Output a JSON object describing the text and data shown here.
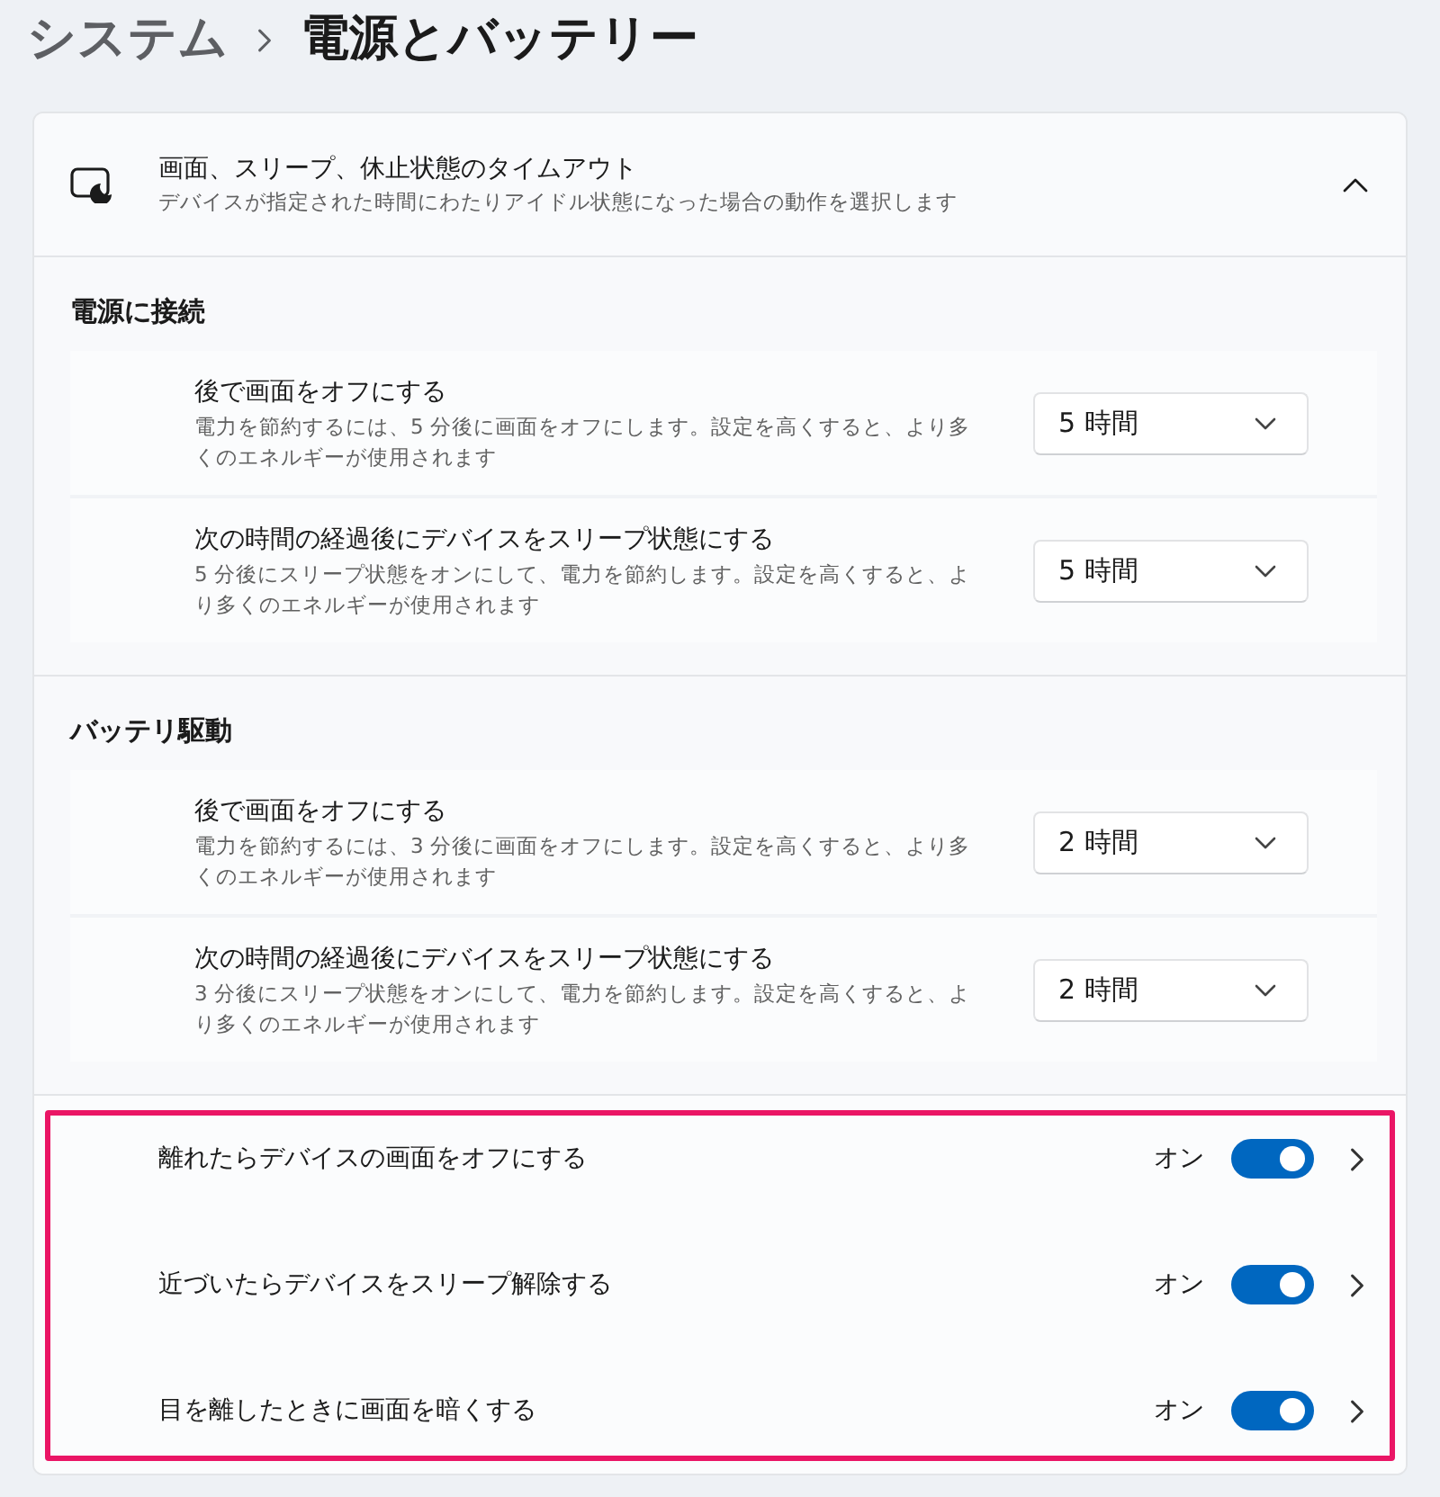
{
  "breadcrumb": [
    {
      "label": "システム",
      "current": false
    },
    {
      "label": "電源とバッテリー",
      "current": true
    }
  ],
  "panel": {
    "title": "画面、スリープ、休止状態のタイムアウト",
    "subtitle": "デバイスが指定された時間にわたりアイドル状態になった場合の動作を選択します",
    "expanded": true,
    "groups": [
      {
        "heading": "電源に接続",
        "settings": [
          {
            "label": "後で画面をオフにする",
            "description": "電力を節約するには、5 分後に画面をオフにします。設定を高くすると、より多くのエネルギーが使用されます",
            "value": "5 時間"
          },
          {
            "label": "次の時間の経過後にデバイスをスリープ状態にする",
            "description": "5 分後にスリープ状態をオンにして、電力を節約します。設定を高くすると、より多くのエネルギーが使用されます",
            "value": "5 時間"
          }
        ]
      },
      {
        "heading": "バッテリ駆動",
        "settings": [
          {
            "label": "後で画面をオフにする",
            "description": "電力を節約するには、3 分後に画面をオフにします。設定を高くすると、より多くのエネルギーが使用されます",
            "value": "2 時間"
          },
          {
            "label": "次の時間の経過後にデバイスをスリープ状態にする",
            "description": "3 分後にスリープ状態をオンにして、電力を節約します。設定を高くすると、より多くのエネルギーが使用されます",
            "value": "2 時間"
          }
        ]
      }
    ]
  },
  "presence": {
    "highlighted": true,
    "settings": [
      {
        "label": "離れたらデバイスの画面をオフにする",
        "state_label": "オン",
        "on": true
      },
      {
        "label": "近づいたらデバイスをスリープ解除する",
        "state_label": "オン",
        "on": true
      },
      {
        "label": "目を離したときに画面を暗くする",
        "state_label": "オン",
        "on": true
      }
    ]
  }
}
